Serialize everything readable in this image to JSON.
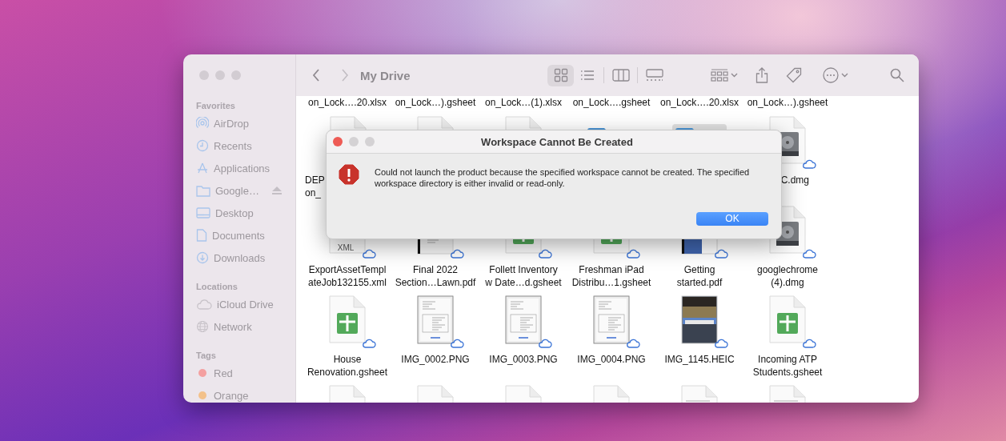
{
  "finder": {
    "sidebar": [
      {
        "heading": "Favorites",
        "items": [
          {
            "kind": "airdrop",
            "label": "AirDrop"
          },
          {
            "kind": "recents",
            "label": "Recents"
          },
          {
            "kind": "applications",
            "label": "Applications"
          },
          {
            "kind": "drive",
            "label": "Google…"
          },
          {
            "kind": "desktop",
            "label": "Desktop"
          },
          {
            "kind": "documents",
            "label": "Documents"
          },
          {
            "kind": "downloads",
            "label": "Downloads"
          }
        ]
      },
      {
        "heading": "Locations",
        "items": [
          {
            "kind": "icloud",
            "label": "iCloud Drive"
          },
          {
            "kind": "network",
            "label": "Network"
          }
        ]
      },
      {
        "heading": "Tags",
        "items": [
          {
            "kind": "tag",
            "label": "Red",
            "color": "#f4a0a0"
          },
          {
            "kind": "tag",
            "label": "Orange",
            "color": "#f3c18a"
          }
        ]
      }
    ],
    "title": "My Drive",
    "views": [
      {
        "kind": "icons",
        "selected": true
      },
      {
        "kind": "list",
        "selected": false
      },
      {
        "kind": "columns",
        "selected": false
      },
      {
        "kind": "gallery",
        "selected": false
      }
    ],
    "top_row_labels": [
      "on_Lock….20.xlsx",
      "on_Lock…).gsheet",
      "on_Lock…(1).xlsx",
      "on_Lock….gsheet",
      "on_Lock….20.xlsx",
      "on_Lock…).gsheet"
    ],
    "rows": [
      [
        {
          "kind": "doc",
          "name": [
            "DEP",
            "on_"
          ],
          "selected": false
        },
        {
          "kind": "doc",
          "selected": false
        },
        {
          "kind": "doc",
          "selected": false
        },
        {
          "kind": "folder",
          "selected": false
        },
        {
          "kind": "folder",
          "selected": true
        },
        {
          "kind": "dmg",
          "name": [
            "C.dmg"
          ],
          "cloud": true,
          "selected": false
        }
      ],
      [
        {
          "kind": "xml",
          "type_label": "XML",
          "name": [
            "ExportAssetTempl",
            "ateJob132155.xml"
          ],
          "cloud": true,
          "selected": false
        },
        {
          "kind": "pdf",
          "name": [
            "Final 2022",
            "Section…Lawn.pdf"
          ],
          "cloud": true,
          "selected": false
        },
        {
          "kind": "gsheet",
          "name": [
            "Follett Inventory",
            "w Date…d.gsheet"
          ],
          "cloud": true,
          "selected": false
        },
        {
          "kind": "gsheet",
          "name": [
            "Freshman iPad",
            "Distribu…1.gsheet"
          ],
          "cloud": true,
          "selected": false
        },
        {
          "kind": "bluepdf",
          "name": [
            "Getting",
            "started.pdf"
          ],
          "cloud": true,
          "selected": false
        },
        {
          "kind": "dmg",
          "name": [
            "googlechrome",
            "(4).dmg"
          ],
          "cloud": true,
          "selected": false
        }
      ],
      [
        {
          "kind": "gsheet",
          "name": [
            "House",
            "Renovation.gsheet"
          ],
          "cloud": true,
          "selected": false
        },
        {
          "kind": "screenshot",
          "name": [
            "IMG_0002.PNG"
          ],
          "cloud": true,
          "selected": false
        },
        {
          "kind": "screenshot",
          "name": [
            "IMG_0003.PNG"
          ],
          "cloud": true,
          "selected": false
        },
        {
          "kind": "screenshot",
          "name": [
            "IMG_0004.PNG"
          ],
          "cloud": true,
          "selected": false
        },
        {
          "kind": "photo",
          "name": [
            "IMG_1145.HEIC"
          ],
          "cloud": true,
          "selected": false
        },
        {
          "kind": "gsheet",
          "name": [
            "Incoming ATP",
            "Students.gsheet"
          ],
          "cloud": true,
          "selected": false
        }
      ],
      [
        {
          "kind": "gsheet",
          "selected": false
        },
        {
          "kind": "doc",
          "selected": false
        },
        {
          "kind": "doc",
          "selected": false
        },
        {
          "kind": "doc",
          "selected": false
        },
        {
          "kind": "text",
          "selected": false
        },
        {
          "kind": "text",
          "selected": false
        }
      ]
    ]
  },
  "dialog": {
    "title": "Workspace Cannot Be Created",
    "message": "Could not launch the product because the specified workspace cannot be created. The specified workspace directory is either invalid or read-only.",
    "button": "OK"
  }
}
